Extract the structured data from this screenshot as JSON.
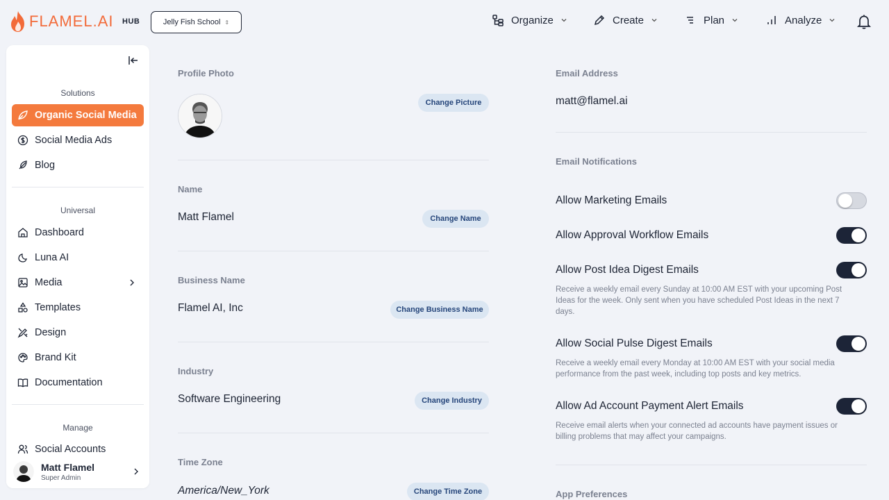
{
  "app": {
    "brand": "FLAMEL.AI",
    "hub": "HUB",
    "workspace": "Jelly Fish School"
  },
  "nav": [
    {
      "label": "Organize",
      "icon": "organize-icon"
    },
    {
      "label": "Create",
      "icon": "pen-icon"
    },
    {
      "label": "Plan",
      "icon": "list-icon"
    },
    {
      "label": "Analyze",
      "icon": "bar-chart-icon"
    }
  ],
  "sidebar": {
    "solutions_label": "Solutions",
    "universal_label": "Universal",
    "manage_label": "Manage",
    "solutions": [
      {
        "label": "Organic Social Media",
        "icon": "leaf-icon",
        "active": true
      },
      {
        "label": "Social Media Ads",
        "icon": "dollar-icon"
      },
      {
        "label": "Blog",
        "icon": "feather-icon"
      }
    ],
    "universal": [
      {
        "label": "Dashboard",
        "icon": "home-icon"
      },
      {
        "label": "Luna AI",
        "icon": "moon-icon"
      },
      {
        "label": "Media",
        "icon": "image-icon"
      },
      {
        "label": "Templates",
        "icon": "shapes-icon"
      },
      {
        "label": "Design",
        "icon": "design-icon"
      },
      {
        "label": "Brand Kit",
        "icon": "palette-icon"
      },
      {
        "label": "Documentation",
        "icon": "book-icon"
      }
    ],
    "manage": [
      {
        "label": "Social Accounts",
        "icon": "users-icon"
      }
    ],
    "user": {
      "name": "Matt Flamel",
      "role": "Super Admin"
    }
  },
  "profile": {
    "photo_label": "Profile Photo",
    "change_picture": "Change Picture",
    "name_label": "Name",
    "name": "Matt Flamel",
    "change_name": "Change Name",
    "business_label": "Business Name",
    "business": "Flamel AI, Inc",
    "change_business": "Change Business Name",
    "industry_label": "Industry",
    "industry": "Software Engineering",
    "change_industry": "Change Industry",
    "timezone_label": "Time Zone",
    "timezone": "America/New_York",
    "change_timezone": "Change Time Zone"
  },
  "email": {
    "address_label": "Email Address",
    "address": "matt@flamel.ai",
    "notifications_label": "Email Notifications",
    "toggles": [
      {
        "label": "Allow Marketing Emails",
        "on": false,
        "desc": ""
      },
      {
        "label": "Allow Approval Workflow Emails",
        "on": true,
        "desc": ""
      },
      {
        "label": "Allow Post Idea Digest Emails",
        "on": true,
        "desc": "Receive a weekly email every Sunday at 10:00 AM EST with your upcoming Post Ideas for the week. Only sent when you have scheduled Post Ideas in the next 7 days."
      },
      {
        "label": "Allow Social Pulse Digest Emails",
        "on": true,
        "desc": "Receive a weekly email every Monday at 10:00 AM EST with your social media performance from the past week, including top posts and key metrics."
      },
      {
        "label": "Allow Ad Account Payment Alert Emails",
        "on": true,
        "desc": "Receive email alerts when your connected ad accounts have payment issues or billing problems that may affect your campaigns."
      }
    ],
    "app_prefs_label": "App Preferences"
  },
  "colors": {
    "accent": "#f47a3d",
    "brand": "#f26b3a",
    "toggle_on": "#1c2437",
    "pill_bg": "#dbe6f2",
    "pill_text": "#25457a"
  }
}
